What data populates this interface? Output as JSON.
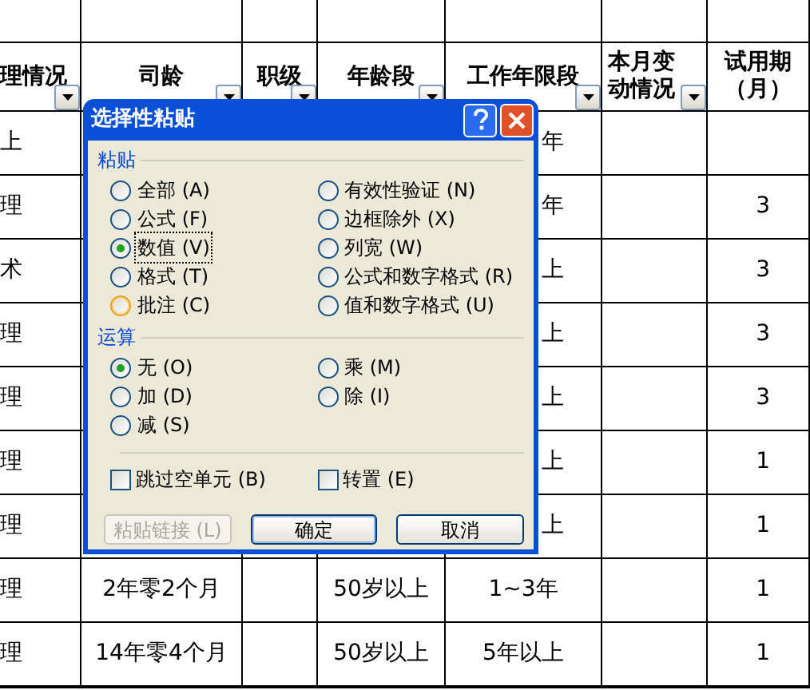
{
  "spreadsheet": {
    "header": [
      {
        "text": "理情况",
        "filter": true
      },
      {
        "text": "司龄",
        "filter": true
      },
      {
        "text": "职级",
        "filter": true
      },
      {
        "text": "年龄段",
        "filter": true
      },
      {
        "text": "工作年限段",
        "filter": true
      },
      {
        "text": "本月变动情况",
        "filter": true
      },
      {
        "text": "试用期（月）",
        "filter": false
      }
    ],
    "rows": [
      [
        "上",
        null,
        null,
        null,
        "年",
        null,
        null
      ],
      [
        "理",
        null,
        null,
        null,
        "年",
        null,
        "3"
      ],
      [
        "术",
        null,
        null,
        null,
        "上",
        null,
        "3"
      ],
      [
        "理",
        null,
        null,
        null,
        "上",
        null,
        "3"
      ],
      [
        "理",
        null,
        null,
        null,
        "上",
        null,
        "3"
      ],
      [
        "理",
        null,
        null,
        null,
        "上",
        null,
        "1"
      ],
      [
        "理",
        null,
        null,
        null,
        "上",
        null,
        "1"
      ],
      [
        "理",
        "2年零2个月",
        null,
        "50岁以上",
        "1~3年",
        null,
        "1"
      ],
      [
        "理",
        "14年零4个月",
        null,
        "50岁以上",
        "5年以上",
        null,
        "1"
      ]
    ]
  },
  "dialog": {
    "title": "选择性粘贴",
    "paste_group": {
      "label": "粘贴",
      "options": [
        {
          "label": "全部 (A)",
          "selected": false,
          "focused": false,
          "hovered": false
        },
        {
          "label": "公式 (F)",
          "selected": false,
          "focused": false,
          "hovered": false
        },
        {
          "label": "数值 (V)",
          "selected": true,
          "focused": true,
          "hovered": false
        },
        {
          "label": "格式 (T)",
          "selected": false,
          "focused": false,
          "hovered": false
        },
        {
          "label": "批注 (C)",
          "selected": false,
          "focused": false,
          "hovered": true
        },
        {
          "label": "有效性验证 (N)",
          "selected": false,
          "focused": false,
          "hovered": false
        },
        {
          "label": "边框除外 (X)",
          "selected": false,
          "focused": false,
          "hovered": false
        },
        {
          "label": "列宽 (W)",
          "selected": false,
          "focused": false,
          "hovered": false
        },
        {
          "label": "公式和数字格式 (R)",
          "selected": false,
          "focused": false,
          "hovered": false
        },
        {
          "label": "值和数字格式 (U)",
          "selected": false,
          "focused": false,
          "hovered": false
        }
      ]
    },
    "operation_group": {
      "label": "运算",
      "options": [
        {
          "label": "无 (O)",
          "selected": true
        },
        {
          "label": "加 (D)",
          "selected": false
        },
        {
          "label": "减 (S)",
          "selected": false
        },
        {
          "label": "乘 (M)",
          "selected": false
        },
        {
          "label": "除 (I)",
          "selected": false
        }
      ]
    },
    "checkboxes": [
      {
        "label": "跳过空单元 (B)",
        "checked": false
      },
      {
        "label": "转置 (E)",
        "checked": false
      }
    ],
    "buttons": [
      {
        "label": "粘贴链接 (L)",
        "disabled": true
      },
      {
        "label": "确定",
        "disabled": false
      },
      {
        "label": "取消",
        "disabled": false
      }
    ]
  }
}
